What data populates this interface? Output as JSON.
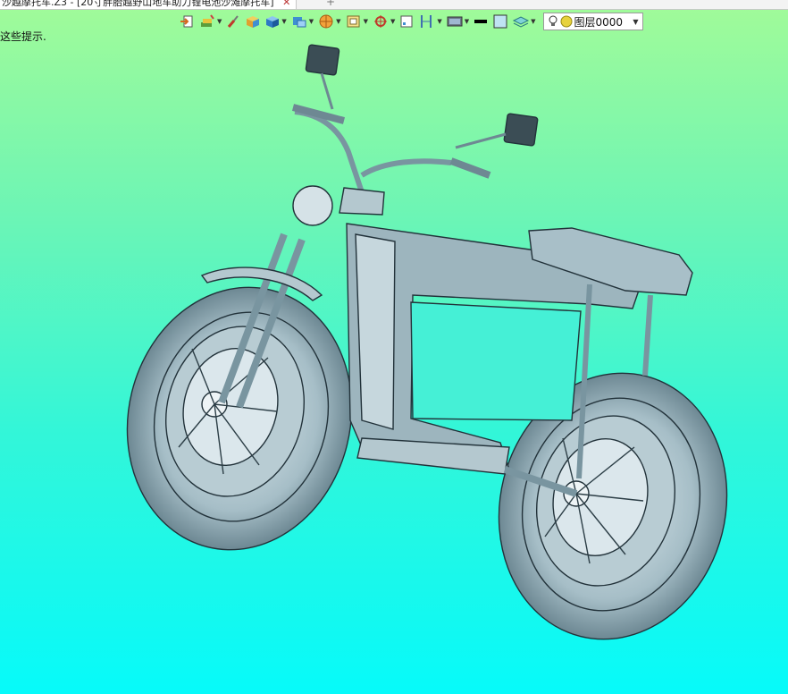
{
  "tab": {
    "title": "沙越摩托车.Z3 - [20寸胖胎越野山地车助力锂电池沙滩摩托车]",
    "close_glyph": "✕",
    "new_tab_glyph": "+"
  },
  "hint": {
    "text": "这些提示."
  },
  "layer": {
    "selected": "图层0000"
  },
  "toolbar_icons": [
    "export-icon",
    "paint-layers-icon",
    "brush-icon",
    "solid-box-icon",
    "blue-cube-icon",
    "view-cube-icon",
    "render-sphere-icon",
    "shaded-frame-icon",
    "snap-target-icon",
    "grid-icon",
    "align-icon",
    "display-settings-icon",
    "line-color-swatch",
    "fill-color-swatch",
    "layer-stack-icon"
  ],
  "colors": {
    "bg_top": "#a2fb98",
    "bg_bottom": "#06fafa",
    "model_fill": "#a9c3cc",
    "model_edge": "#22323a"
  }
}
